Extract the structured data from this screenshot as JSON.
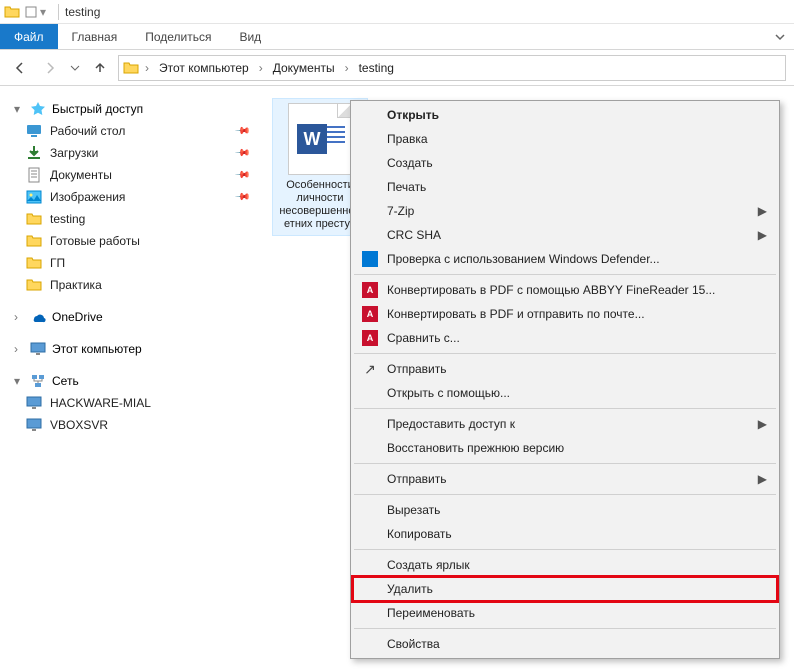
{
  "titlebar": {
    "title": "testing"
  },
  "ribbon": {
    "file": "Файл",
    "home": "Главная",
    "share": "Поделиться",
    "view": "Вид"
  },
  "breadcrumb": {
    "root": "Этот компьютер",
    "documents": "Документы",
    "folder": "testing"
  },
  "sidebar": {
    "quick_access": "Быстрый доступ",
    "items": [
      {
        "label": "Рабочий стол",
        "icon": "desktop",
        "pinned": true
      },
      {
        "label": "Загрузки",
        "icon": "downloads",
        "pinned": true
      },
      {
        "label": "Документы",
        "icon": "documents",
        "pinned": true
      },
      {
        "label": "Изображения",
        "icon": "pictures",
        "pinned": true
      },
      {
        "label": "testing",
        "icon": "folder",
        "pinned": false
      },
      {
        "label": "Готовые работы",
        "icon": "folder",
        "pinned": false
      },
      {
        "label": "ГП",
        "icon": "folder",
        "pinned": false
      },
      {
        "label": "Практика",
        "icon": "folder",
        "pinned": false
      }
    ],
    "onedrive": "OneDrive",
    "this_pc": "Этот компьютер",
    "network": "Сеть",
    "computers": [
      {
        "label": "HACKWARE-MIAL"
      },
      {
        "label": "VBOXSVR"
      }
    ]
  },
  "file": {
    "name": "Особенности личности несовершеннолетних преступ"
  },
  "context_menu": {
    "open": "Открыть",
    "edit": "Правка",
    "create": "Создать",
    "print": "Печать",
    "sevenzip": "7-Zip",
    "crcsha": "CRC SHA",
    "defender": "Проверка с использованием Windows Defender...",
    "abbyy_convert": "Конвертировать в PDF с помощью ABBYY FineReader 15...",
    "abbyy_send": "Конвертировать в PDF и отправить по почте...",
    "abbyy_compare": "Сравнить с...",
    "send_external": "Отправить",
    "open_with": "Открыть с помощью...",
    "grant_access": "Предоставить доступ к",
    "restore": "Восстановить прежнюю версию",
    "send_to": "Отправить",
    "cut": "Вырезать",
    "copy": "Копировать",
    "create_shortcut": "Создать ярлык",
    "delete": "Удалить",
    "rename": "Переименовать",
    "properties": "Свойства"
  }
}
